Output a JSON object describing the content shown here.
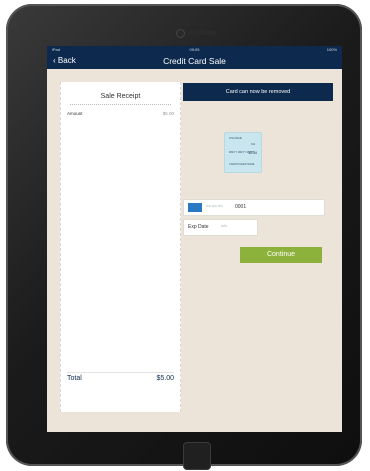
{
  "status_bar": {
    "carrier": "iPad",
    "time": "09:05",
    "battery": "100%"
  },
  "nav": {
    "back_label": "Back",
    "title": "Credit Card Sale"
  },
  "receipt": {
    "title": "Sale Receipt",
    "amount_label": "Amount",
    "amount_value": "$5.00",
    "total_label": "Total",
    "total_value": "$5.00"
  },
  "banner": {
    "text": "Card can now be removed"
  },
  "card_image": {
    "bank": "VISA BANK",
    "code": "012",
    "dates": "MM/YY  MM/YY  MM/YY",
    "number": "1234",
    "holder": "CARDHOLDER NAME"
  },
  "card_field": {
    "brand_icon": "amex-card-icon",
    "masked": "•••• •••• ••••",
    "last4": "0001"
  },
  "exp_field": {
    "label": "Exp Date",
    "value": "••/••"
  },
  "continue_button": {
    "label": "Continue"
  },
  "colors": {
    "navy": "#0d2a4e",
    "accent_green": "#8db23c",
    "background": "#ece4d8"
  }
}
